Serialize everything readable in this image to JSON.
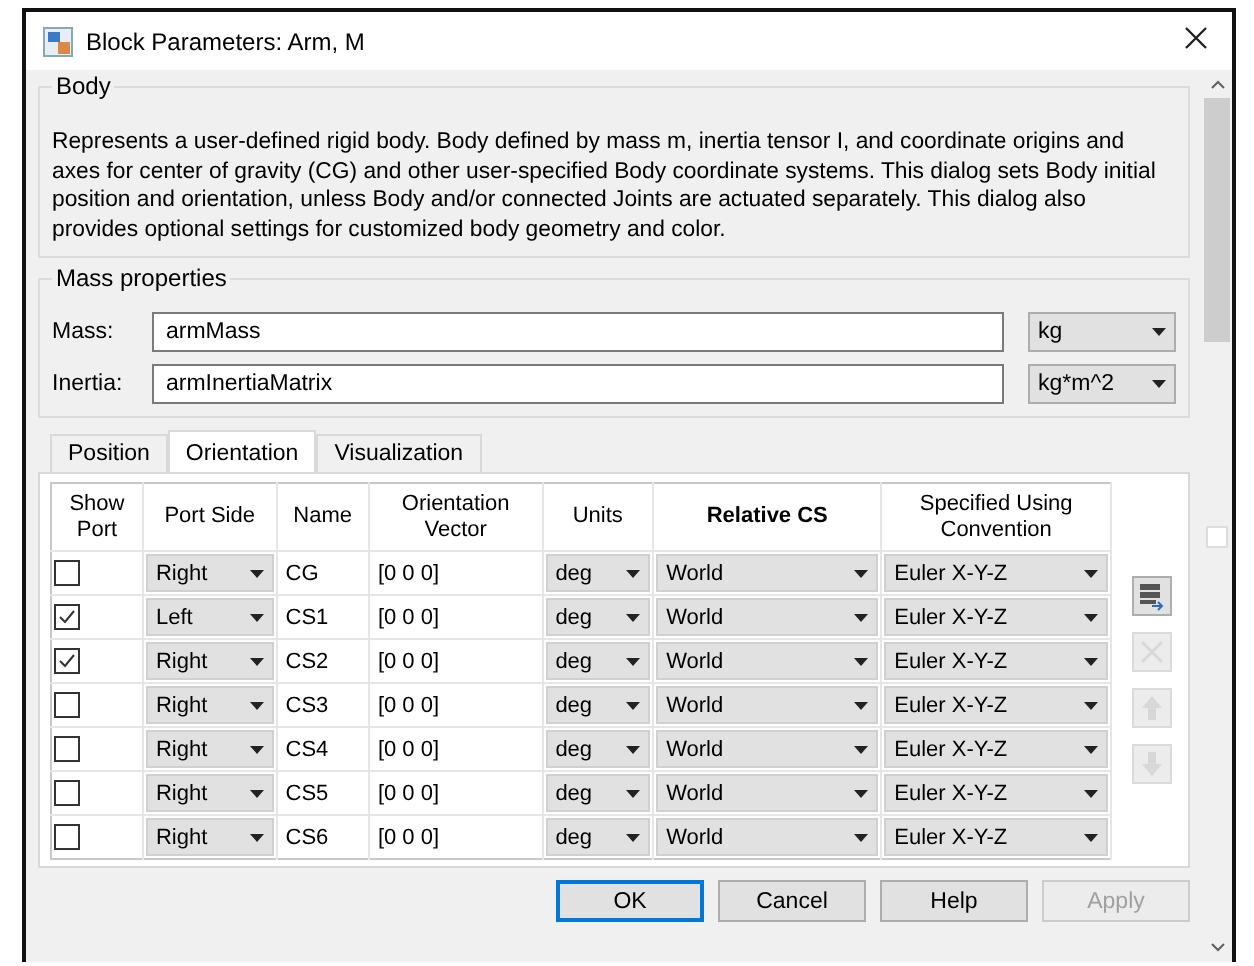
{
  "window": {
    "title": "Block Parameters: Arm, M"
  },
  "body_group": {
    "title": "Body",
    "description": "Represents a user-defined rigid body. Body defined by mass m, inertia tensor I, and coordinate origins and axes for center of gravity (CG) and other user-specified Body coordinate systems. This dialog sets Body initial position and orientation, unless Body and/or connected Joints are actuated separately. This dialog also provides optional settings for customized body geometry and color."
  },
  "mass_group": {
    "title": "Mass properties",
    "fields": [
      {
        "label": "Mass:",
        "value": "armMass",
        "unit": "kg"
      },
      {
        "label": "Inertia:",
        "value": "armInertiaMatrix",
        "unit": "kg*m^2"
      }
    ]
  },
  "tabs": [
    {
      "label": "Position",
      "selected": false
    },
    {
      "label": "Orientation",
      "selected": true
    },
    {
      "label": "Visualization",
      "selected": false
    }
  ],
  "table": {
    "columns": [
      {
        "label": "Show Port",
        "bold": false
      },
      {
        "label": "Port Side",
        "bold": false
      },
      {
        "label": "Name",
        "bold": false
      },
      {
        "label": "Orientation Vector",
        "bold": false
      },
      {
        "label": "Units",
        "bold": false
      },
      {
        "label": "Relative CS",
        "bold": true
      },
      {
        "label": "Specified Using Convention",
        "bold": false
      }
    ],
    "rows": [
      {
        "checked": false,
        "port_side": "Right",
        "name": "CG",
        "vector": "[0 0 0]",
        "units": "deg",
        "relative": "World",
        "convention": "Euler X-Y-Z"
      },
      {
        "checked": true,
        "port_side": "Left",
        "name": "CS1",
        "vector": "[0 0 0]",
        "units": "deg",
        "relative": "World",
        "convention": "Euler X-Y-Z"
      },
      {
        "checked": true,
        "port_side": "Right",
        "name": "CS2",
        "vector": "[0 0 0]",
        "units": "deg",
        "relative": "World",
        "convention": "Euler X-Y-Z"
      },
      {
        "checked": false,
        "port_side": "Right",
        "name": "CS3",
        "vector": "[0 0 0]",
        "units": "deg",
        "relative": "World",
        "convention": "Euler X-Y-Z"
      },
      {
        "checked": false,
        "port_side": "Right",
        "name": "CS4",
        "vector": "[0 0 0]",
        "units": "deg",
        "relative": "World",
        "convention": "Euler X-Y-Z"
      },
      {
        "checked": false,
        "port_side": "Right",
        "name": "CS5",
        "vector": "[0 0 0]",
        "units": "deg",
        "relative": "World",
        "convention": "Euler X-Y-Z"
      },
      {
        "checked": false,
        "port_side": "Right",
        "name": "CS6",
        "vector": "[0 0 0]",
        "units": "deg",
        "relative": "World",
        "convention": "Euler X-Y-Z"
      }
    ]
  },
  "row_tools": [
    {
      "kind": "add",
      "disabled": false
    },
    {
      "kind": "delete",
      "disabled": true
    },
    {
      "kind": "up",
      "disabled": true
    },
    {
      "kind": "down",
      "disabled": true
    }
  ],
  "buttons": [
    {
      "label": "OK",
      "default": true,
      "disabled": false
    },
    {
      "label": "Cancel",
      "default": false,
      "disabled": false
    },
    {
      "label": "Help",
      "default": false,
      "disabled": false
    },
    {
      "label": "Apply",
      "default": false,
      "disabled": true
    }
  ]
}
